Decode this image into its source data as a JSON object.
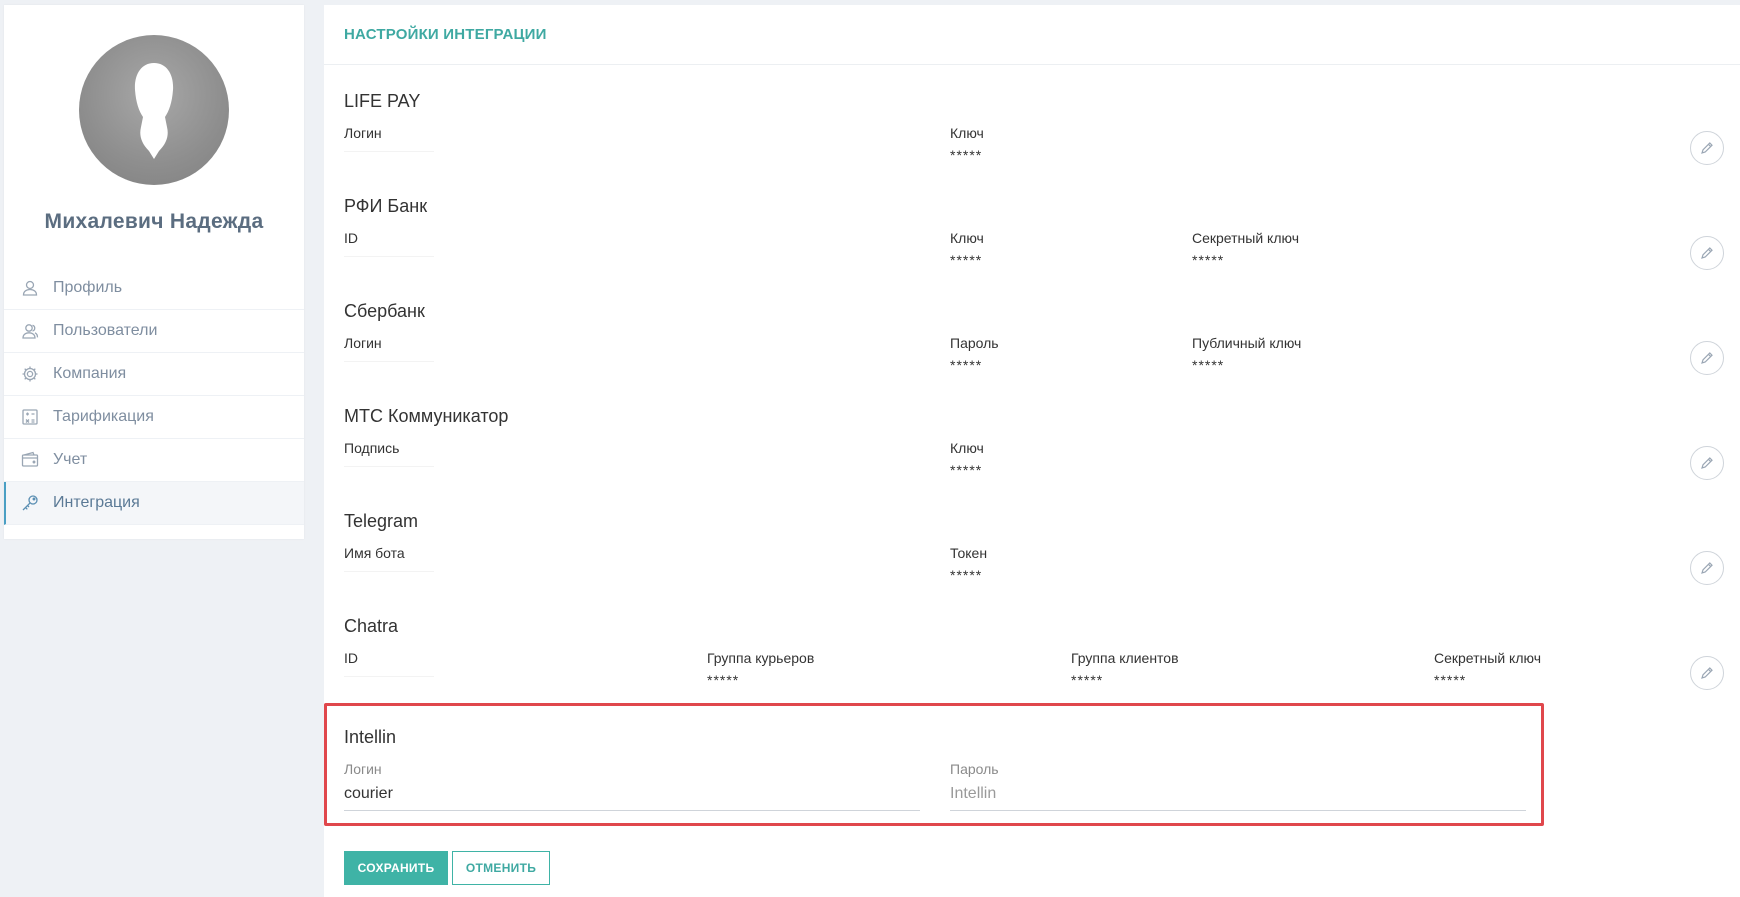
{
  "sidebar": {
    "user_name": "Михалевич Надежда",
    "items": [
      {
        "label": "Профиль",
        "icon": "user-icon"
      },
      {
        "label": "Пользователи",
        "icon": "users-icon"
      },
      {
        "label": "Компания",
        "icon": "gear-icon"
      },
      {
        "label": "Тарификация",
        "icon": "calculator-icon"
      },
      {
        "label": "Учет",
        "icon": "wallet-icon"
      },
      {
        "label": "Интеграция",
        "icon": "key-icon",
        "active": true
      }
    ]
  },
  "main": {
    "title": "НАСТРОЙКИ ИНТЕГРАЦИИ",
    "integrations": [
      {
        "name": "LIFE PAY",
        "fields": [
          {
            "label": "Логин",
            "value": ""
          },
          {
            "label": "Ключ",
            "value": "*****"
          }
        ]
      },
      {
        "name": "РФИ Банк",
        "fields": [
          {
            "label": "ID",
            "value": ""
          },
          {
            "label": "Ключ",
            "value": "*****"
          },
          {
            "label": "Секретный ключ",
            "value": "*****"
          }
        ]
      },
      {
        "name": "Сбербанк",
        "fields": [
          {
            "label": "Логин",
            "value": ""
          },
          {
            "label": "Пароль",
            "value": "*****"
          },
          {
            "label": "Публичный ключ",
            "value": "*****"
          }
        ]
      },
      {
        "name": "МТС Коммуникатор",
        "fields": [
          {
            "label": "Подпись",
            "value": ""
          },
          {
            "label": "Ключ",
            "value": "*****"
          }
        ]
      },
      {
        "name": "Telegram",
        "fields": [
          {
            "label": "Имя бота",
            "value": ""
          },
          {
            "label": "Токен",
            "value": "*****"
          }
        ]
      },
      {
        "name": "Chatra",
        "fields": [
          {
            "label": "ID",
            "value": ""
          },
          {
            "label": "Группа курьеров",
            "value": "*****"
          },
          {
            "label": "Группа клиентов",
            "value": "*****"
          },
          {
            "label": "Секретный ключ",
            "value": "*****"
          }
        ]
      }
    ],
    "intellin": {
      "name": "Intellin",
      "login_label": "Логин",
      "login_value": "courier",
      "password_label": "Пароль",
      "password_placeholder": "Intellin"
    },
    "buttons": {
      "save": "СОХРАНИТЬ",
      "cancel": "ОТМЕНИТЬ"
    }
  },
  "colors": {
    "accent": "#3fa9a2",
    "highlight_border": "#e0474c",
    "nav_active_border": "#4a9fc4"
  }
}
